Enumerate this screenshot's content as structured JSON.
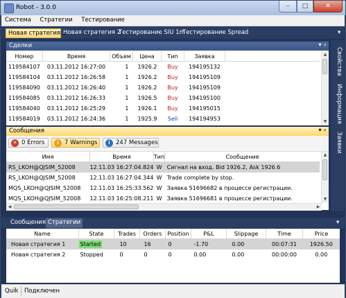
{
  "window": {
    "title": "Robot - 3.0.0",
    "minimize_glyph": "–",
    "maximize_glyph": "□",
    "close_glyph": "✕"
  },
  "menu": [
    "Система",
    "Стратегии",
    "Тестирование"
  ],
  "doc_tabs": [
    "Новая стратегия 1",
    "Новая стратегия 2",
    "Тестирование SIU 1m",
    "Тестирование Spread"
  ],
  "doc_tabs_pin_glyph": "▾",
  "trades": {
    "title": "Сделки",
    "pin_glyph": "▾ ⫞",
    "columns": [
      "Номер",
      "Время",
      "Объем",
      "Цена",
      "Тип",
      "Заявка"
    ],
    "rows": [
      [
        "119584107",
        "03.11.2012 16:27:00",
        "1",
        "1926.2",
        "Buy",
        "194195132"
      ],
      [
        "119584104",
        "03.11.2012 16:26:58",
        "1",
        "1926.2",
        "Buy",
        "194195109"
      ],
      [
        "119584090",
        "03.11.2012 16:26:40",
        "1",
        "1926.2",
        "Buy",
        "194195109"
      ],
      [
        "119584085",
        "03.11.2012 16:26:33",
        "1",
        "1926.5",
        "Buy",
        "194195100"
      ],
      [
        "119584040",
        "03.11.2012 16:25:29",
        "1",
        "1926.1",
        "Buy",
        "194195015"
      ],
      [
        "119584019",
        "03.11.2012 16:24:36",
        "1",
        "1925.9",
        "Sell",
        "194194953"
      ]
    ]
  },
  "side_tabs": [
    "Свойства",
    "Информация",
    "Заявки"
  ],
  "messages": {
    "title": "Сообщения",
    "pin_glyph": "▾ ⫞",
    "filters": [
      {
        "icon": "error-icon",
        "glyph": "✕",
        "color": "#c8412c",
        "label": "0 Errors"
      },
      {
        "icon": "warning-icon",
        "glyph": "!",
        "color": "#e8a21a",
        "label": "7 Warnings"
      },
      {
        "icon": "info-icon",
        "glyph": "i",
        "color": "#2f6dc7",
        "label": "247 Messages"
      }
    ],
    "columns": [
      "Имя",
      "Время",
      "Тип",
      "Сообщение"
    ],
    "rows": [
      [
        "RS_LKOH@QJSIM_52008",
        "12.11.03 16:27:04.824",
        "W",
        "Сигнал на вход. Bid 1926.2, Ask 1926.6"
      ],
      [
        "RS_LKOH@QJSIM_52008",
        "12.11.03 16:27:04.344",
        "W",
        "Trade complete by stop."
      ],
      [
        "MQS_LKOH@QJSIM_52008",
        "12.11.03 16:25:33.562",
        "W",
        "Заявка 51696682 в процессе регистрации."
      ],
      [
        "MQS_LKOH@QJSIM_52008",
        "12.11.03 16:25:08.211",
        "W",
        "Заявка 51696681 в процессе регистрации."
      ]
    ]
  },
  "bottom_tabs": [
    "Сообщения",
    "Стратегии"
  ],
  "bottom_pin_glyph": "▾",
  "strategies": {
    "columns": [
      "Name",
      "State",
      "Trades",
      "Orders",
      "Position",
      "P&L",
      "Slippage",
      "Time",
      "Price"
    ],
    "rows": [
      [
        "Новая стратегия 1",
        "Started",
        "10",
        "16",
        "0",
        "-1.70",
        "0.00",
        "00:07:31",
        "1926.50"
      ],
      [
        "Новая стратегия 2",
        "Stopped",
        "0",
        "0",
        "0",
        "0.00",
        "0.00",
        "00:00:00",
        "0.00"
      ]
    ]
  },
  "status": {
    "connector": "Quik",
    "state": "Подключен"
  },
  "colors": {
    "buy": "#c0181c",
    "sell": "#1a3fb8",
    "started_badge": "#7ddc77"
  }
}
